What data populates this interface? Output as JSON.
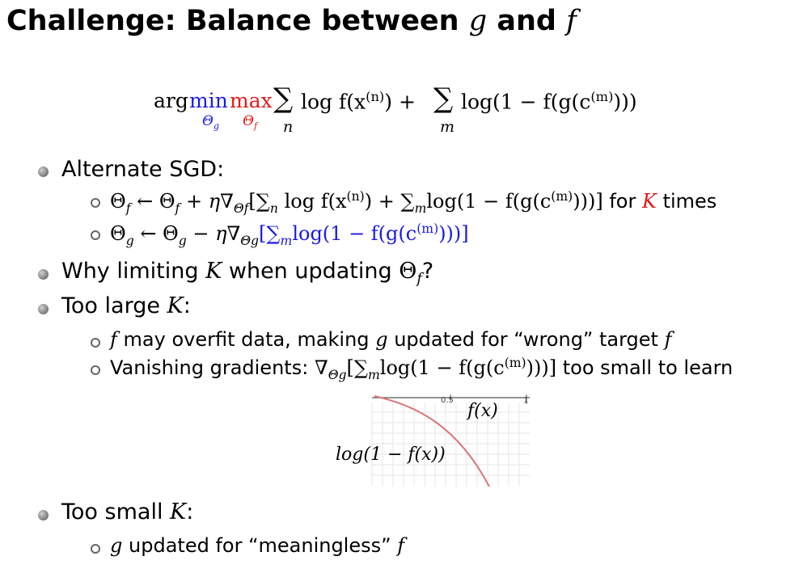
{
  "title": {
    "text": "Challenge:  Balance between",
    "var_g": "g",
    "and": "and",
    "var_f": "f"
  },
  "objective": {
    "arg": "arg",
    "min": "min",
    "max": "max",
    "min_sub": "Θ",
    "min_sub_sub": "g",
    "max_sub": "Θ",
    "max_sub_sub": "f",
    "sum1_index": "n",
    "sum2_index": "m",
    "term1": "log f(x",
    "term1_sup": "(n)",
    "term1_end": ") +",
    "term2": "log(1 − f(g(c",
    "term2_sup": "(m)",
    "term2_end": ")))"
  },
  "bullets": {
    "alt_sgd": "Alternate SGD:",
    "sgd1_pre": "Θ",
    "sgd1_expr": "← Θ",
    "sgd1_mid": "+ η∇",
    "sgd1_bracket": "[∑",
    "sgd1_body1": "log f(x",
    "sgd1_sup1": "(n)",
    "sgd1_body2": ") + ∑",
    "sgd1_body3": "log(1 − f(g(c",
    "sgd1_sup2": "(m)",
    "sgd1_body4": ")))]",
    "sgd1_for": "for",
    "sgd1_K": "K",
    "sgd1_times": "times",
    "sgd2_pre": "Θ",
    "sgd2_expr": "← Θ",
    "sgd2_mid": "− η∇",
    "sgd2_bracket": "[∑",
    "sgd2_body": "log(1 − f(g(c",
    "sgd2_sup": "(m)",
    "sgd2_end": ")))]",
    "why": "Why limiting",
    "why_K": "K",
    "why_mid": "when updating",
    "why_theta": "Θ",
    "why_end": "?",
    "too_large": "Too large",
    "too_large_K": "K",
    "too_large_end": ":",
    "overfit_f": "f",
    "overfit_text": "may overfit data, making",
    "overfit_g": "g",
    "overfit_text2": "updated for “wrong” target",
    "overfit_f2": "f",
    "vanish_text": "Vanishing gradients:",
    "vanish_nabla": "∇",
    "vanish_bracket": "[∑",
    "vanish_body": "log(1 − f(g(c",
    "vanish_sup": "(m)",
    "vanish_end": ")))]",
    "vanish_tail": "too small to learn",
    "too_small": "Too small",
    "too_small_K": "K",
    "too_small_end": ":",
    "meaningless_g": "g",
    "meaningless_text": "updated for “meaningless”",
    "meaningless_f": "f"
  },
  "plot": {
    "tick_05": "0.5",
    "tick_1": "1",
    "label_f": "f(x)",
    "label_log": "log(1 − f(x))"
  },
  "colors": {
    "blue": "#1a1ae6",
    "red": "#e11b1b",
    "curve": "#d9777a"
  }
}
